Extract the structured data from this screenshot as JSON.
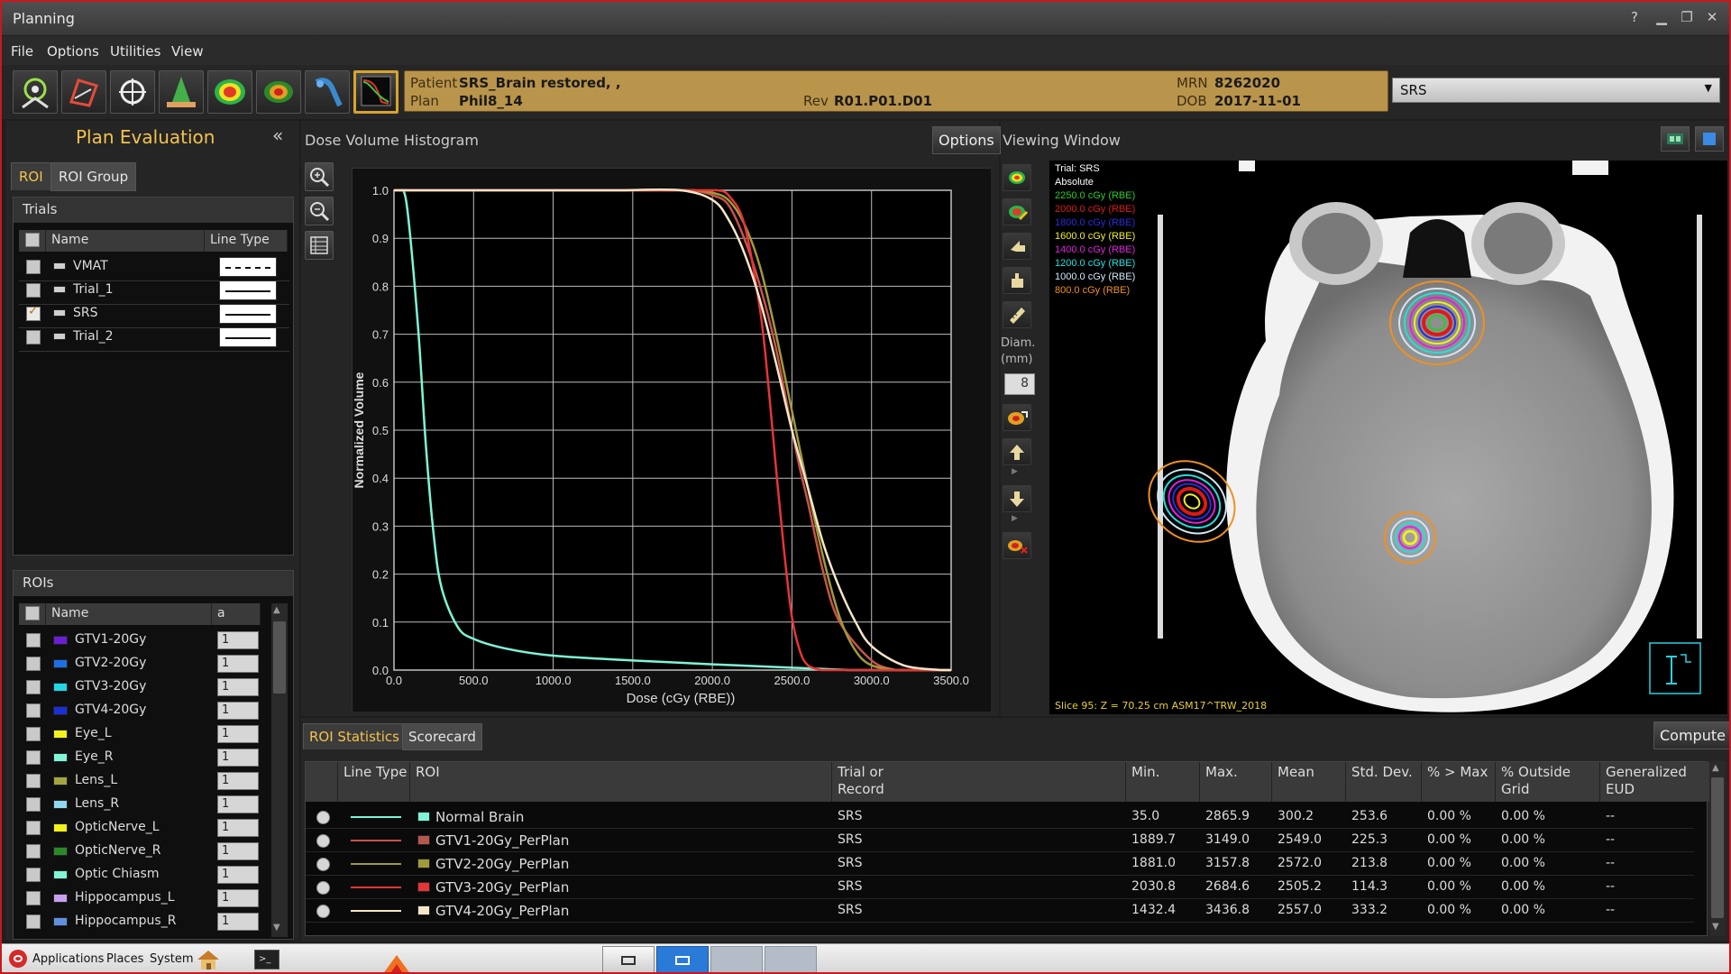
{
  "window": {
    "title": "Planning",
    "help": "?",
    "minimize": "▁",
    "restore": "❐",
    "close": "✕"
  },
  "menu": [
    "File",
    "Options",
    "Utilities",
    "View"
  ],
  "patient": {
    "patient_label": "Patient",
    "patient_value": "SRS_Brain restored, ,",
    "plan_label": "Plan",
    "plan_value": "Phil8_14",
    "rev_label": "Rev",
    "rev_value": "R01.P01.D01",
    "mrn_label": "MRN",
    "mrn_value": "8262020",
    "dob_label": "DOB",
    "dob_value": "2017-11-01"
  },
  "trial_combo": "SRS",
  "left": {
    "title": "Plan Evaluation",
    "collapse_icon": "«",
    "tabs": [
      "ROI",
      "ROI Group"
    ],
    "trials_title": "Trials",
    "trials_cols": [
      "Name",
      "Line Type"
    ],
    "trials": [
      {
        "name": "VMAT",
        "checked": false,
        "line": "dashed"
      },
      {
        "name": "Trial_1",
        "checked": false,
        "line": "solid"
      },
      {
        "name": "SRS",
        "checked": true,
        "line": "solid"
      },
      {
        "name": "Trial_2",
        "checked": false,
        "line": "solid"
      }
    ],
    "rois_title": "ROIs",
    "rois_cols": [
      "Name",
      "a"
    ],
    "rois": [
      {
        "name": "GTV1-20Gy",
        "color": "#6a1fd6",
        "a": "1"
      },
      {
        "name": "GTV2-20Gy",
        "color": "#1e6fe6",
        "a": "1"
      },
      {
        "name": "GTV3-20Gy",
        "color": "#22d6e6",
        "a": "1"
      },
      {
        "name": "GTV4-20Gy",
        "color": "#1a2fd8",
        "a": "1"
      },
      {
        "name": "Eye_L",
        "color": "#f4f01e",
        "a": "1"
      },
      {
        "name": "Eye_R",
        "color": "#7ff5d6",
        "a": "1"
      },
      {
        "name": "Lens_L",
        "color": "#a6a640",
        "a": "1"
      },
      {
        "name": "Lens_R",
        "color": "#8fd9f0",
        "a": "1"
      },
      {
        "name": "OpticNerve_L",
        "color": "#f4f01e",
        "a": "1"
      },
      {
        "name": "OpticNerve_R",
        "color": "#2a8a2a",
        "a": "1"
      },
      {
        "name": "Optic Chiasm",
        "color": "#7ff5d6",
        "a": "1"
      },
      {
        "name": "Hippocampus_L",
        "color": "#c8a0f0",
        "a": "1"
      },
      {
        "name": "Hippocampus_R",
        "color": "#6090e0",
        "a": "1"
      }
    ]
  },
  "dvh": {
    "title": "Dose Volume Histogram",
    "options_label": "Options",
    "tools": [
      "zoom-in-icon",
      "zoom-out-icon",
      "table-icon"
    ]
  },
  "chart_data": {
    "type": "line",
    "xlabel": "Dose (cGy (RBE))",
    "ylabel": "Normalized Volume",
    "xlim": [
      0,
      3500
    ],
    "ylim": [
      0,
      1.0
    ],
    "xticks": [
      "0.0",
      "500.0",
      "1000.0",
      "1500.0",
      "2000.0",
      "2500.0",
      "3000.0",
      "3500.0"
    ],
    "yticks": [
      "0.0",
      "0.1",
      "0.2",
      "0.3",
      "0.4",
      "0.5",
      "0.6",
      "0.7",
      "0.8",
      "0.9",
      "1.0"
    ],
    "grid": true,
    "series": [
      {
        "name": "Normal Brain",
        "color": "#7ff5d6",
        "x": [
          35,
          80,
          150,
          200,
          250,
          300,
          400,
          500,
          700,
          1000,
          1500,
          2000,
          2500,
          2866
        ],
        "y": [
          1.0,
          0.97,
          0.72,
          0.47,
          0.28,
          0.17,
          0.09,
          0.065,
          0.045,
          0.03,
          0.02,
          0.012,
          0.005,
          0.0
        ]
      },
      {
        "name": "GTV1-20Gy_PerPlan",
        "color": "#c9524c",
        "x": [
          1890,
          2000,
          2100,
          2200,
          2300,
          2400,
          2500,
          2550,
          2600,
          2700,
          2800,
          3000,
          3149
        ],
        "y": [
          1.0,
          0.99,
          0.97,
          0.9,
          0.8,
          0.67,
          0.5,
          0.42,
          0.35,
          0.2,
          0.1,
          0.02,
          0.0
        ]
      },
      {
        "name": "GTV2-20Gy_PerPlan",
        "color": "#a09a3a",
        "x": [
          1881,
          2000,
          2100,
          2200,
          2300,
          2400,
          2500,
          2600,
          2700,
          2800,
          2900,
          3000,
          3158
        ],
        "y": [
          1.0,
          0.995,
          0.98,
          0.93,
          0.84,
          0.7,
          0.54,
          0.38,
          0.23,
          0.11,
          0.04,
          0.01,
          0.0
        ]
      },
      {
        "name": "GTV3-20Gy_PerPlan",
        "color": "#e83434",
        "x": [
          2031,
          2100,
          2200,
          2300,
          2350,
          2400,
          2450,
          2500,
          2550,
          2600,
          2685
        ],
        "y": [
          1.0,
          0.99,
          0.93,
          0.75,
          0.6,
          0.42,
          0.25,
          0.11,
          0.04,
          0.01,
          0.0
        ]
      },
      {
        "name": "GTV4-20Gy_PerPlan",
        "color": "#f6e5c8",
        "x": [
          1432,
          1800,
          2000,
          2100,
          2200,
          2300,
          2400,
          2500,
          2600,
          2700,
          2800,
          2900,
          3000,
          3200,
          3437
        ],
        "y": [
          1.0,
          1.0,
          0.98,
          0.94,
          0.87,
          0.77,
          0.64,
          0.5,
          0.38,
          0.26,
          0.17,
          0.1,
          0.05,
          0.01,
          0.0
        ]
      }
    ]
  },
  "viewing": {
    "title": "Viewing Window",
    "diam_label": "Diam.\n(mm)",
    "diam_value": "8",
    "legend": [
      {
        "text": "Trial: SRS",
        "color": "#ffffff"
      },
      {
        "text": "Absolute",
        "color": "#ffffff"
      },
      {
        "text": "2250.0 cGy (RBE)",
        "color": "#22d022"
      },
      {
        "text": "2000.0 cGy (RBE)",
        "color": "#e01818"
      },
      {
        "text": "1800.0 cGy (RBE)",
        "color": "#2a2ae0"
      },
      {
        "text": "1600.0 cGy (RBE)",
        "color": "#f0f020"
      },
      {
        "text": "1400.0 cGy (RBE)",
        "color": "#e020e0"
      },
      {
        "text": "1200.0 cGy (RBE)",
        "color": "#20e0e0"
      },
      {
        "text": "1000.0 cGy (RBE)",
        "color": "#d0e8f8"
      },
      {
        "text": "800.0 cGy (RBE)",
        "color": "#f09020"
      }
    ],
    "slice_text": "Slice 95: Z = 70.25 cm ASM17^TRW_2018"
  },
  "stats": {
    "tabs": [
      "ROI Statistics",
      "Scorecard"
    ],
    "compute_label": "Compute",
    "columns": [
      "",
      "Line Type",
      "ROI",
      "Trial or\nRecord",
      "Min.",
      "Max.",
      "Mean",
      "Std. Dev.",
      "% > Max",
      "% Outside\nGrid",
      "Generalized\nEUD"
    ],
    "rows": [
      {
        "line": "#7ff5d6",
        "swatch": "#7ff5d6",
        "roi": "Normal Brain",
        "trial": "SRS",
        "min": "35.0",
        "max": "2865.9",
        "mean": "300.2",
        "std": "253.6",
        "pmax": "0.00 %",
        "pout": "0.00 %",
        "eud": "--"
      },
      {
        "line": "#c9524c",
        "swatch": "#b5574e",
        "roi": "GTV1-20Gy_PerPlan",
        "trial": "SRS",
        "min": "1889.7",
        "max": "3149.0",
        "mean": "2549.0",
        "std": "225.3",
        "pmax": "0.00 %",
        "pout": "0.00 %",
        "eud": "--"
      },
      {
        "line": "#a09a3a",
        "swatch": "#a09a3a",
        "roi": "GTV2-20Gy_PerPlan",
        "trial": "SRS",
        "min": "1881.0",
        "max": "3157.8",
        "mean": "2572.0",
        "std": "213.8",
        "pmax": "0.00 %",
        "pout": "0.00 %",
        "eud": "--"
      },
      {
        "line": "#e83434",
        "swatch": "#e83434",
        "roi": "GTV3-20Gy_PerPlan",
        "trial": "SRS",
        "min": "2030.8",
        "max": "2684.6",
        "mean": "2505.2",
        "std": "114.3",
        "pmax": "0.00 %",
        "pout": "0.00 %",
        "eud": "--"
      },
      {
        "line": "#f6e5c8",
        "swatch": "#f6e5c8",
        "roi": "GTV4-20Gy_PerPlan",
        "trial": "SRS",
        "min": "1432.4",
        "max": "3436.8",
        "mean": "2557.0",
        "std": "333.2",
        "pmax": "0.00 %",
        "pout": "0.00 %",
        "eud": "--"
      }
    ]
  },
  "taskbar": {
    "applications": "Applications",
    "places": "Places",
    "system": "System"
  }
}
